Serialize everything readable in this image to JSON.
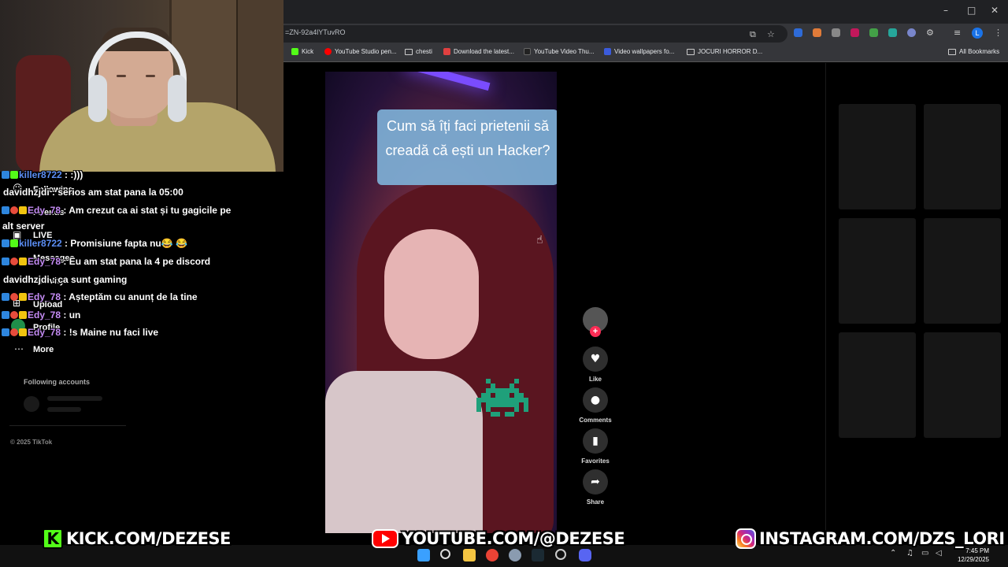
{
  "browser": {
    "url": "=ZN-92a4lYTuvRO",
    "window_controls": [
      "–",
      "□",
      "✕"
    ],
    "bookmarks": [
      {
        "label": "Kick",
        "icon": "kick-icon",
        "color": "#53fc18"
      },
      {
        "label": "YouTube Studio pen...",
        "icon": "youtube-icon",
        "color": "#ff0000"
      },
      {
        "label": "chesti",
        "icon": "folder-icon"
      },
      {
        "label": "Download the latest...",
        "icon": "page-icon",
        "color": "#e04040"
      },
      {
        "label": "YouTube Video Thu...",
        "icon": "page-icon",
        "color": "#222222"
      },
      {
        "label": "Video wallpapers fo...",
        "icon": "page-icon",
        "color": "#3b5bdb"
      },
      {
        "label": "JOCURI HORROR D...",
        "icon": "folder-icon"
      }
    ],
    "all_bookmarks": "All Bookmarks",
    "profile_initial": "L"
  },
  "tiktok_nav": {
    "items": [
      "Following",
      "Friends",
      "LIVE",
      "Messages",
      "Activity",
      "Upload",
      "Profile"
    ],
    "more": "More",
    "following_accounts": "Following accounts",
    "copyright": "© 2025 TikTok"
  },
  "chat": [
    {
      "user": "killer8722",
      "message": " : :)))",
      "color": "#5b8ef5"
    },
    {
      "user": "davidhzjdi",
      "message": " : serios am stat pana la 05:00",
      "color": "#ffffff"
    },
    {
      "user": "Edy_78",
      "message": " : Am crezut ca ai stat și tu gagicile pe",
      "color": "#c58cf5"
    },
    {
      "user": "",
      "message": "alt server",
      "color": "#ffffff"
    },
    {
      "user": "killer8722",
      "message": " : Promisiune fapta nu😂 😂",
      "color": "#5b8ef5"
    },
    {
      "user": "Edy_78",
      "message": " : Eu am stat pana la 4 pe discord",
      "color": "#c58cf5"
    },
    {
      "user": "davidhzjdi",
      "message": " : ca sunt gaming",
      "color": "#ffffff"
    },
    {
      "user": "Edy_78",
      "message": " : Așteptăm cu anunț de la tine",
      "color": "#c58cf5"
    },
    {
      "user": "Edy_78",
      "message": " : un",
      "color": "#c58cf5"
    },
    {
      "user": "Edy_78",
      "message": " : !s Maine nu faci live",
      "color": "#c58cf5"
    }
  ],
  "video": {
    "caption": "Cum să îți faci prietenii să creadă că ești un Hacker?"
  },
  "actions": [
    {
      "label": "Like",
      "icon": "heart-icon"
    },
    {
      "label": "Comments",
      "icon": "comment-icon"
    },
    {
      "label": "Favorites",
      "icon": "bookmark-icon"
    },
    {
      "label": "Share",
      "icon": "share-icon"
    }
  ],
  "overlay": {
    "kick": "KICK.COM/DEZESE",
    "youtube": "YOUTUBE.COM/@DEZESE",
    "instagram": "INSTAGRAM.COM/DZS_LORI"
  },
  "taskbar": {
    "time": "7:45 PM",
    "date": "12/29/2025"
  },
  "colors": {
    "accent_pink": "#fe2c55",
    "kick_green": "#53fc18",
    "youtube_red": "#ff0000",
    "chat_user_blue": "#5b8ef5",
    "chat_user_purple": "#c58cf5"
  }
}
